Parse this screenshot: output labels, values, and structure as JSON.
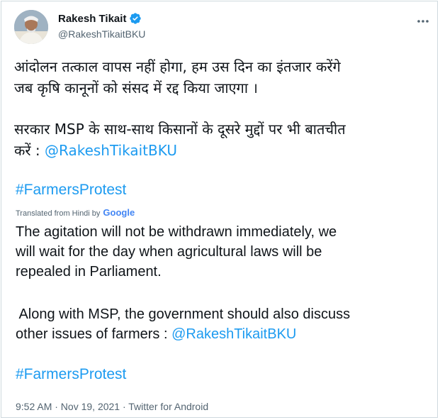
{
  "tweet": {
    "author": {
      "name": "Rakesh Tikait",
      "handle": "@RakeshTikaitBKU",
      "avatar_icon": "user-avatar",
      "verified_icon": "verified-badge-icon"
    },
    "more_icon": "more-options-icon",
    "hindi": {
      "para1_line1": "आंदोलन तत्काल वापस नहीं होगा, हम उस दिन का इंतजार करेंगे",
      "para1_line2": "जब कृषि कानूनों को संसद में रद्द किया जाएगा ।",
      "para2_line1": "सरकार MSP के साथ-साथ किसानों के दूसरे मुद्दों पर भी बातचीत",
      "para2_line2_prefix": "करें : ",
      "mention": "@RakeshTikaitBKU",
      "hashtag": "#FarmersProtest"
    },
    "translation": {
      "label": "Translated from Hindi by",
      "provider": "Google",
      "para1_line1": "The agitation will not be withdrawn immediately, we",
      "para1_line2": "will wait for the day when agricultural laws will be",
      "para1_line3": "repealed in Parliament.",
      "para2_line1": " Along with MSP, the government should also discuss",
      "para2_line2_prefix": "other issues of farmers : ",
      "mention": "@RakeshTikaitBKU",
      "hashtag": "#FarmersProtest"
    },
    "timestamp": "9:52 AM · Nov 19, 2021 · Twitter for Android"
  },
  "colors": {
    "link": "#1d9bf0",
    "text": "#0f1419",
    "secondary": "#536471",
    "border": "#cfd9de"
  }
}
